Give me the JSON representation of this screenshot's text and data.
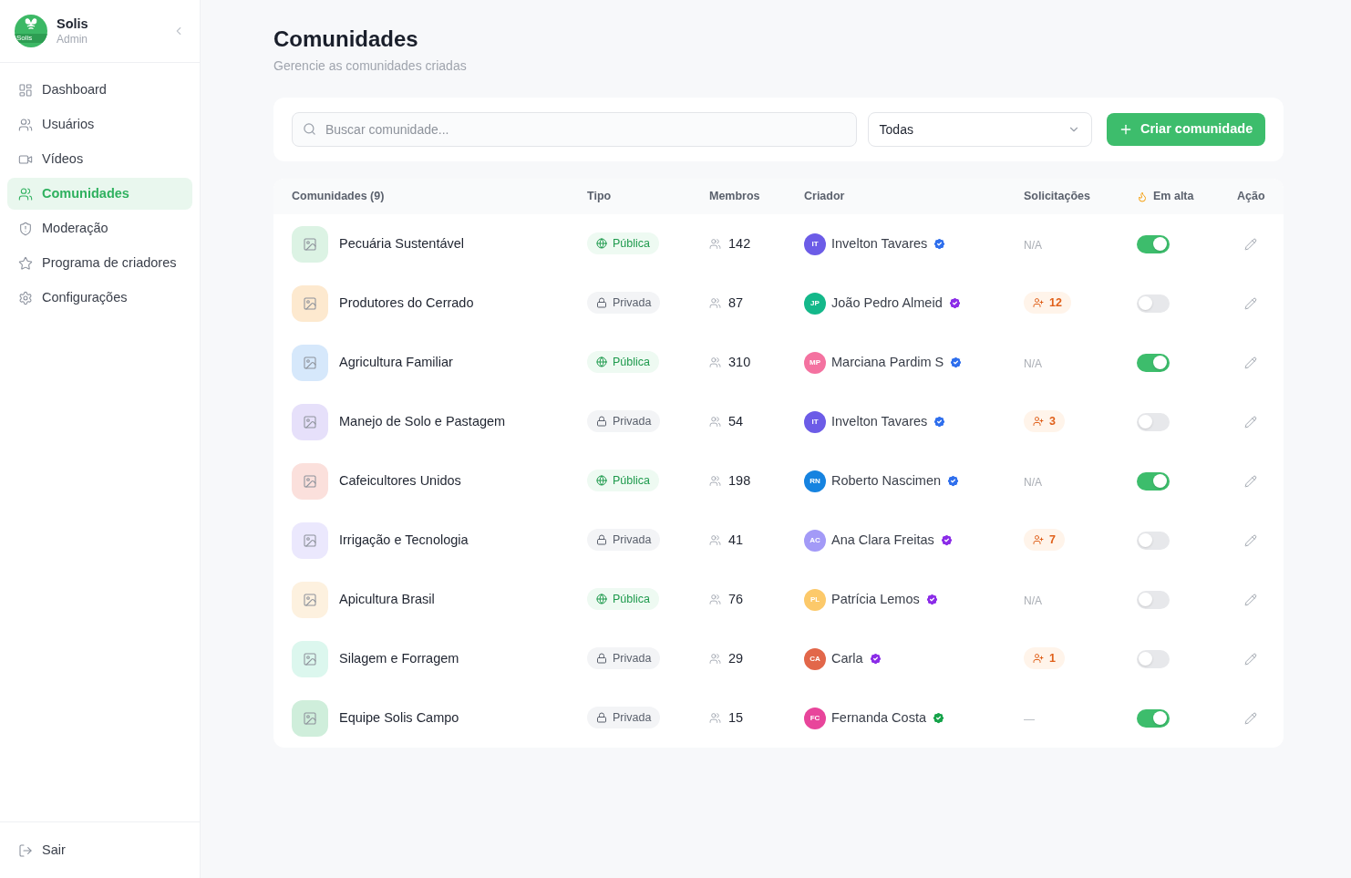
{
  "brand": {
    "logo_text": "Solis",
    "name": "Solis",
    "role": "Admin"
  },
  "sidebar": {
    "items": [
      {
        "kind": "dashboard",
        "label": "Dashboard",
        "selected": false
      },
      {
        "kind": "users",
        "label": "Usuários",
        "selected": false
      },
      {
        "kind": "video",
        "label": "Vídeos",
        "selected": false
      },
      {
        "kind": "users",
        "label": "Comunidades",
        "selected": true
      },
      {
        "kind": "shield",
        "label": "Moderação",
        "selected": false
      },
      {
        "kind": "star",
        "label": "Programa de criadores",
        "selected": false
      },
      {
        "kind": "settings",
        "label": "Configurações",
        "selected": false
      }
    ],
    "logout": "Sair"
  },
  "page": {
    "title": "Comunidades",
    "subtitle": "Gerencie as comunidades criadas"
  },
  "toolbar": {
    "search": {
      "placeholder": "Buscar comunidade..."
    },
    "filter": {
      "value": "Todas"
    },
    "create_button": "Criar comunidade"
  },
  "table": {
    "columns": [
      "Comunidades (9)",
      "Tipo",
      "Membros",
      "Criador",
      "Solicitações",
      "Em alta",
      "Ação"
    ],
    "rows": [
      {
        "name": "Pecuária Sustentável",
        "color": "#dcf3e4",
        "type": {
          "kind": "public",
          "label": "Pública"
        },
        "members": "142",
        "creator": {
          "initials": "IT",
          "name": "Invelton Tavares",
          "color": "#6c5ce7",
          "badge": {
            "color": "#2f6fed"
          }
        },
        "requests": {
          "kind": "na",
          "text": "N/A"
        },
        "trending": true
      },
      {
        "name": "Produtores do Cerrado",
        "color": "#fde9cf",
        "type": {
          "kind": "private",
          "label": "Privada"
        },
        "members": "87",
        "creator": {
          "initials": "JP",
          "name": "João Pedro Almeid",
          "color": "#14b88a",
          "badge": {
            "color": "#8b2ce8"
          }
        },
        "requests": {
          "kind": "count",
          "text": "12"
        },
        "trending": false
      },
      {
        "name": "Agricultura Familiar",
        "color": "#d6e8fb",
        "type": {
          "kind": "public",
          "label": "Pública"
        },
        "members": "310",
        "creator": {
          "initials": "MP",
          "name": "Marciana Pardim S",
          "color": "#f472a0",
          "badge": {
            "color": "#2f6fed"
          }
        },
        "requests": {
          "kind": "na",
          "text": "N/A"
        },
        "trending": true
      },
      {
        "name": "Manejo de Solo e Pastagem",
        "color": "#e6e0fa",
        "type": {
          "kind": "private",
          "label": "Privada"
        },
        "members": "54",
        "creator": {
          "initials": "IT",
          "name": "Invelton Tavares",
          "color": "#6c5ce7",
          "badge": {
            "color": "#2f6fed"
          }
        },
        "requests": {
          "kind": "count",
          "text": "3"
        },
        "trending": false
      },
      {
        "name": "Cafeicultores Unidos",
        "color": "#fbe0dc",
        "type": {
          "kind": "public",
          "label": "Pública"
        },
        "members": "198",
        "creator": {
          "initials": "RN",
          "name": "Roberto Nascimen",
          "color": "#1683e0",
          "badge": {
            "color": "#2f6fed"
          }
        },
        "requests": {
          "kind": "na",
          "text": "N/A"
        },
        "trending": true
      },
      {
        "name": "Irrigação e Tecnologia",
        "color": "#ebe8fd",
        "type": {
          "kind": "private",
          "label": "Privada"
        },
        "members": "41",
        "creator": {
          "initials": "AC",
          "name": "Ana Clara Freitas",
          "color": "#a39af7",
          "badge": {
            "color": "#8b2ce8"
          }
        },
        "requests": {
          "kind": "count",
          "text": "7"
        },
        "trending": false
      },
      {
        "name": "Apicultura Brasil",
        "color": "#fdf1df",
        "type": {
          "kind": "public",
          "label": "Pública"
        },
        "members": "76",
        "creator": {
          "initials": "PL",
          "name": "Patrícia Lemos",
          "color": "#fcc96a",
          "badge": {
            "color": "#8b2ce8"
          }
        },
        "requests": {
          "kind": "na",
          "text": "N/A"
        },
        "trending": false
      },
      {
        "name": "Silagem e Forragem",
        "color": "#dcf7ee",
        "type": {
          "kind": "private",
          "label": "Privada"
        },
        "members": "29",
        "creator": {
          "initials": "CA",
          "name": "Carla",
          "color": "#e2674a",
          "badge": {
            "color": "#8b2ce8"
          }
        },
        "requests": {
          "kind": "count",
          "text": "1"
        },
        "trending": false
      },
      {
        "name": "Equipe Solis Campo",
        "color": "#cfeedb",
        "type": {
          "kind": "private",
          "label": "Privada"
        },
        "members": "15",
        "creator": {
          "initials": "FC",
          "name": "Fernanda Costa",
          "color": "#e8459b",
          "badge": {
            "color": "#16a34a"
          }
        },
        "requests": {
          "kind": "none",
          "text": "—"
        },
        "trending": true
      }
    ]
  }
}
